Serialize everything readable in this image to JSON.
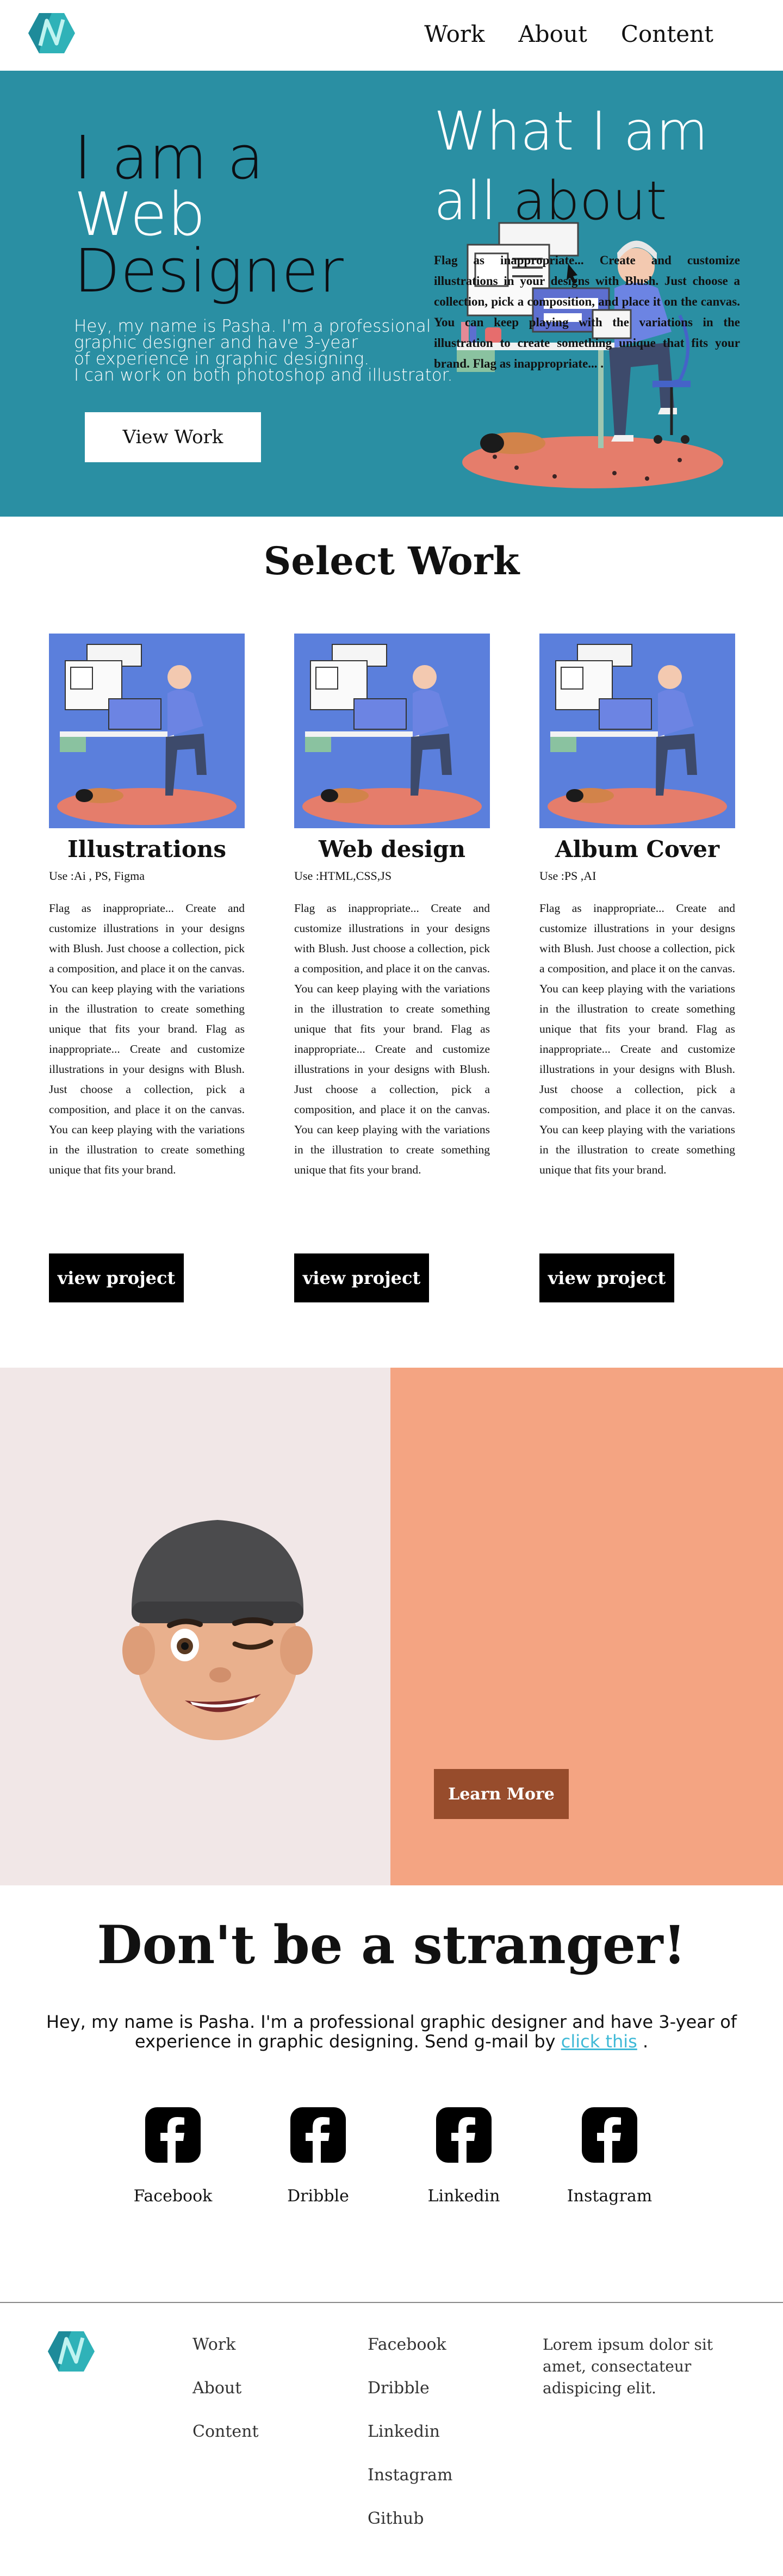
{
  "nav": {
    "links": [
      "Work",
      "About",
      "Content"
    ]
  },
  "hero": {
    "title_line1": "I am a",
    "title_line2": "Web",
    "title_line3": "Designer",
    "text_lines": [
      "Hey, my name is Pasha. I'm a professional",
      "graphic designer and have 3-year",
      "of experience in graphic designing.",
      "I can work on both photoshop and illustrator."
    ],
    "button": "View Work"
  },
  "work": {
    "title": "Select Work",
    "cards": [
      {
        "title": "Illustrations",
        "use": "Use :Ai , PS, Figma",
        "desc": "Flag as inappropriate... Create and customize illustrations in your designs with Blush. Just choose a collection, pick a composition, and place it on the canvas. You can keep playing with the variations in the illustration to create something unique that fits your brand. Flag as inappropriate... Create and customize illustrations in your designs with Blush. Just choose a collection, pick a composition, and place it on the canvas. You can keep playing with the variations in the illustration to create something unique that fits your brand.",
        "button": "view project"
      },
      {
        "title": "Web design",
        "use": "Use :HTML,CSS,JS",
        "desc": "Flag as inappropriate... Create and customize illustrations in your designs with Blush. Just choose a collection, pick a composition, and place it on the canvas. You can keep playing with the variations in the illustration to create something unique that fits your brand. Flag as inappropriate... Create and customize illustrations in your designs with Blush. Just choose a collection, pick a composition, and place it on the canvas. You can keep playing with the variations in the illustration to create something unique that fits your brand.",
        "button": "view project"
      },
      {
        "title": "Album Cover",
        "use": "Use :PS ,AI",
        "desc": "Flag as inappropriate... Create and customize illustrations in your designs with Blush. Just choose a collection, pick a composition, and place it on the canvas. You can keep playing with the variations in the illustration to create something unique that fits your brand. Flag as inappropriate... Create and customize illustrations in your designs with Blush. Just choose a collection, pick a composition, and place it on the canvas. You can keep playing with the variations in the illustration to create something unique that fits your brand.",
        "button": "view project"
      }
    ]
  },
  "about": {
    "title_light_1": "What I am",
    "title_light_2": "all",
    "title_dark": "about",
    "text": "Flag as inappropriate... Create and customize illustrations in your designs with Blush. Just choose a collection, pick a composition, and place it on the canvas. You can keep playing with the variations in the illustration to create something unique that fits your brand. Flag as inappropriate... .",
    "button": "Learn More"
  },
  "contact": {
    "title": "Don't be a stranger!",
    "text_before": "Hey, my name is Pasha. I'm a professional graphic designer and have 3-year of experience in graphic designing.  Send g-mail by ",
    "link": "click this",
    "text_after": " .",
    "socials": [
      "Facebook",
      "Dribble",
      "Linkedin",
      "Instagram"
    ]
  },
  "footer": {
    "col1": [
      "Work",
      "About",
      "Content"
    ],
    "col2": [
      "Facebook",
      "Dribble",
      "Linkedin",
      "Instagram",
      "Github"
    ],
    "text": "Lorem ipsum dolor sit amet, consectateur adispicing elit."
  },
  "colors": {
    "hero_bg": "#2a8fa3",
    "about_left_bg": "#f1e7e7",
    "about_right_bg": "#f4a482",
    "learn_btn": "#974c2c",
    "link": "#3fb9d6"
  }
}
